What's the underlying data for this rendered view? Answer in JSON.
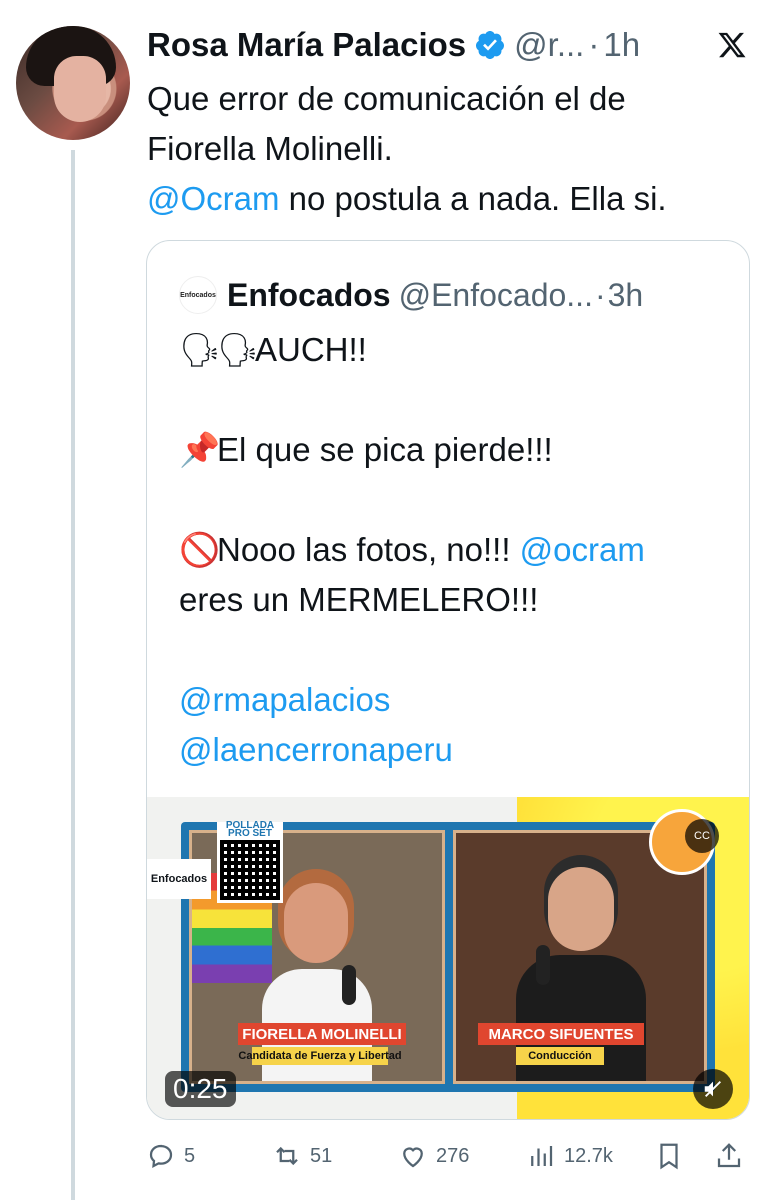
{
  "author": {
    "name": "Rosa María Palacios",
    "handle": "@r...",
    "time": "1h",
    "verified": true
  },
  "tweet": {
    "line1": "Que error de comunicación el de",
    "line2": "Fiorella Molinelli.",
    "mention": "@Ocram",
    "line3_rest": " no postula a nada. Ella si."
  },
  "quote": {
    "logo_text": "Enfocados",
    "name": "Enfocados",
    "handle": "@Enfocado...",
    "time": "3h",
    "line_auch": "AUCH!!",
    "line_pica": "El que se pica pierde!!!",
    "line_nooo": "Nooo las fotos, no!!! ",
    "mention_ocram": "@ocram",
    "line_mermelero": "eres un MERMELERO!!!",
    "mention_rma": "@rmapalacios",
    "mention_encerrona": "@laencerronaperu",
    "emoji_speaking": "🗣",
    "emoji_pin": "📌",
    "emoji_prohibited": "🚫"
  },
  "media": {
    "duration": "0:25",
    "polla": "POLLADA PRO SET",
    "enfocados_tag": "Enfocados",
    "left_name": "FIORELLA MOLINELLI",
    "left_role": "Candidata de Fuerza y Libertad",
    "right_name": "MARCO SIFUENTES",
    "right_role": "Conducción",
    "cc_label": "CC"
  },
  "actions": {
    "replies": "5",
    "reposts": "51",
    "likes": "276",
    "views": "12.7k"
  },
  "colors": {
    "accent": "#1d9bf0",
    "muted": "#536471",
    "border": "#cfd9de"
  }
}
